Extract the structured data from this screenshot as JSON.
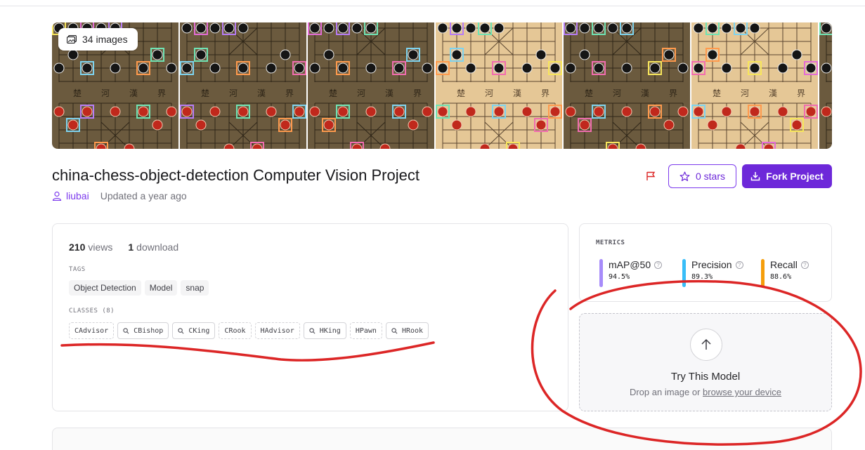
{
  "gallery": {
    "image_count_label": "34 images",
    "images": [
      {
        "board": "dark"
      },
      {
        "board": "dark"
      },
      {
        "board": "dark"
      },
      {
        "board": "light"
      },
      {
        "board": "dark"
      },
      {
        "board": "light"
      },
      {
        "board": "dark"
      }
    ],
    "river_text": [
      "楚",
      "河",
      "漢",
      "界"
    ]
  },
  "project": {
    "title": "china-chess-object-detection Computer Vision Project",
    "author": "liubai",
    "updated": "Updated a year ago"
  },
  "actions": {
    "stars_label": "0 stars",
    "fork_label": "Fork Project"
  },
  "stats": {
    "views_count": "210",
    "views_label": "views",
    "downloads_count": "1",
    "downloads_label": "download"
  },
  "tags": {
    "label": "TAGS",
    "items": [
      "Object Detection",
      "Model",
      "snap"
    ]
  },
  "classes": {
    "label": "CLASSES (8)",
    "items": [
      {
        "name": "CAdvisor",
        "searchable": false
      },
      {
        "name": "CBishop",
        "searchable": true
      },
      {
        "name": "CKing",
        "searchable": true
      },
      {
        "name": "CRook",
        "searchable": false
      },
      {
        "name": "HAdvisor",
        "searchable": false
      },
      {
        "name": "HKing",
        "searchable": true
      },
      {
        "name": "HPawn",
        "searchable": false
      },
      {
        "name": "HRook",
        "searchable": true
      }
    ]
  },
  "metrics": {
    "label": "METRICS",
    "items": [
      {
        "name": "mAP@50",
        "value": "94.5%",
        "color": "#a78bfa"
      },
      {
        "name": "Precision",
        "value": "89.3%",
        "color": "#38bdf8"
      },
      {
        "name": "Recall",
        "value": "88.6%",
        "color": "#f59e0b"
      }
    ]
  },
  "try_model": {
    "title": "Try This Model",
    "subtitle_prefix": "Drop an image or",
    "browse_link": "browse your device"
  },
  "colors": {
    "accent": "#6d28d9",
    "annotation": "#dc2626"
  }
}
